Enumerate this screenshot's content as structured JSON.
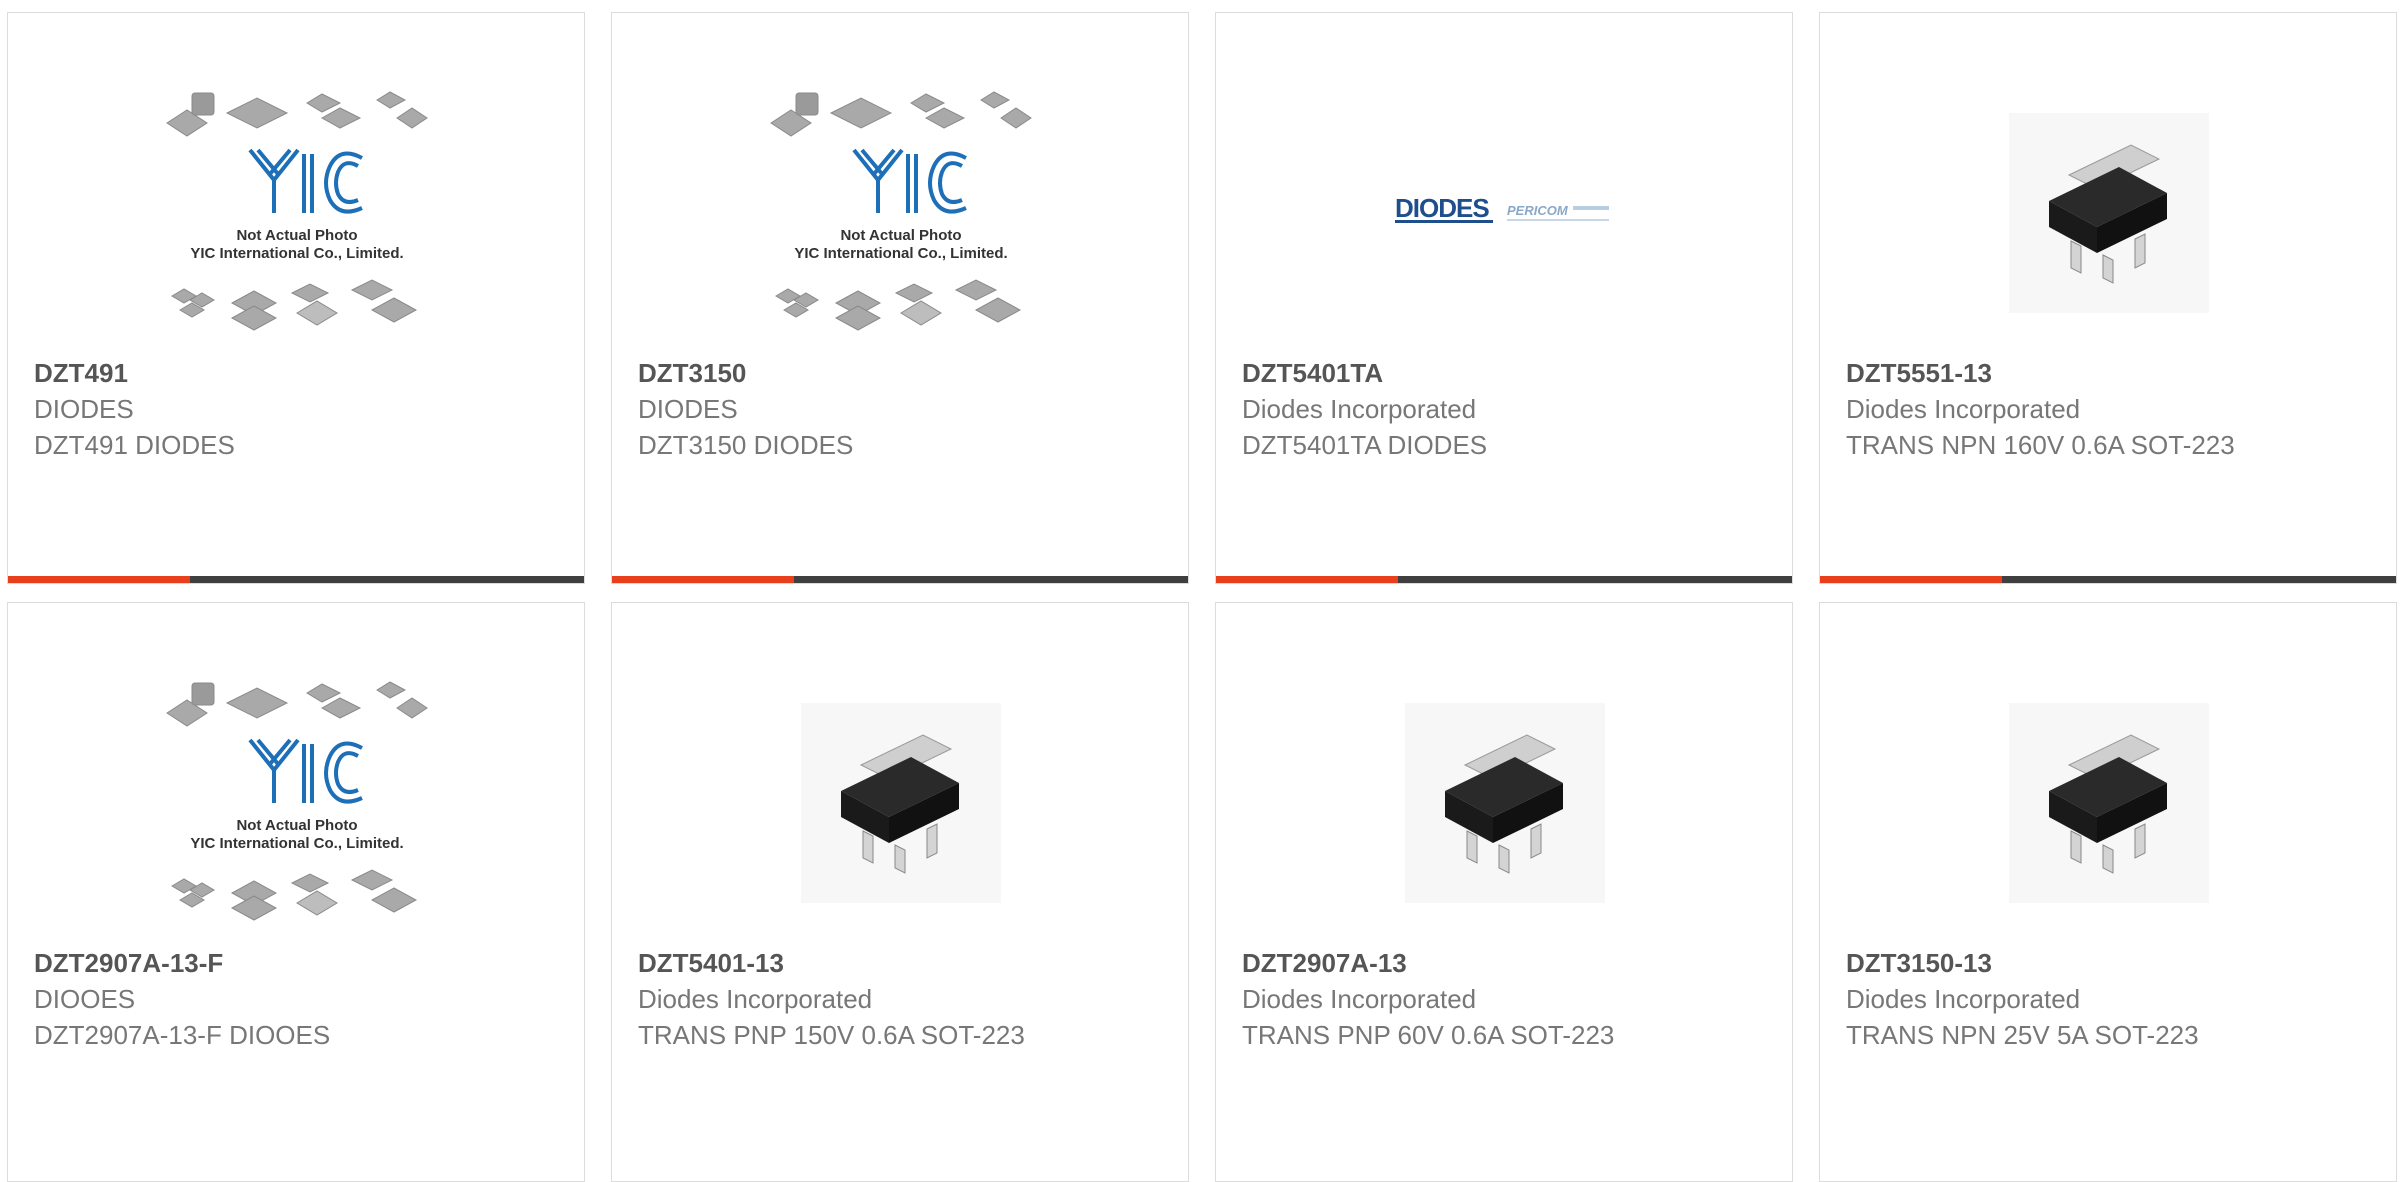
{
  "colors": {
    "accent": "#e8401c",
    "bar": "#3f3f3f",
    "yic_blue": "#1d6fb8"
  },
  "placeholder": {
    "line1": "Not Actual Photo",
    "line2": "YIC International Co., Limited.",
    "logo": "YIC"
  },
  "diodes_logo": {
    "brand": "DIODES",
    "partner": "PERICOM"
  },
  "products": [
    {
      "part": "DZT491",
      "manufacturer": "DIODES",
      "description": "DZT491 DIODES",
      "image": "yic-placeholder-image"
    },
    {
      "part": "DZT3150",
      "manufacturer": "DIODES",
      "description": "DZT3150 DIODES",
      "image": "yic-placeholder-image"
    },
    {
      "part": "DZT5401TA",
      "manufacturer": "Diodes Incorporated",
      "description": "DZT5401TA DIODES",
      "image": "diodes-pericom-logo"
    },
    {
      "part": "DZT5551-13",
      "manufacturer": "Diodes Incorporated",
      "description": "TRANS NPN 160V 0.6A SOT-223",
      "image": "sot223-package-image"
    },
    {
      "part": "DZT2907A-13-F",
      "manufacturer": "DIOOES",
      "description": "DZT2907A-13-F DIOOES",
      "image": "yic-placeholder-image"
    },
    {
      "part": "DZT5401-13",
      "manufacturer": "Diodes Incorporated",
      "description": "TRANS PNP 150V 0.6A SOT-223",
      "image": "sot223-package-image"
    },
    {
      "part": "DZT2907A-13",
      "manufacturer": "Diodes Incorporated",
      "description": "TRANS PNP 60V 0.6A SOT-223",
      "image": "sot223-package-image"
    },
    {
      "part": "DZT3150-13",
      "manufacturer": "Diodes Incorporated",
      "description": "TRANS NPN 25V 5A SOT-223",
      "image": "sot223-package-image"
    }
  ]
}
